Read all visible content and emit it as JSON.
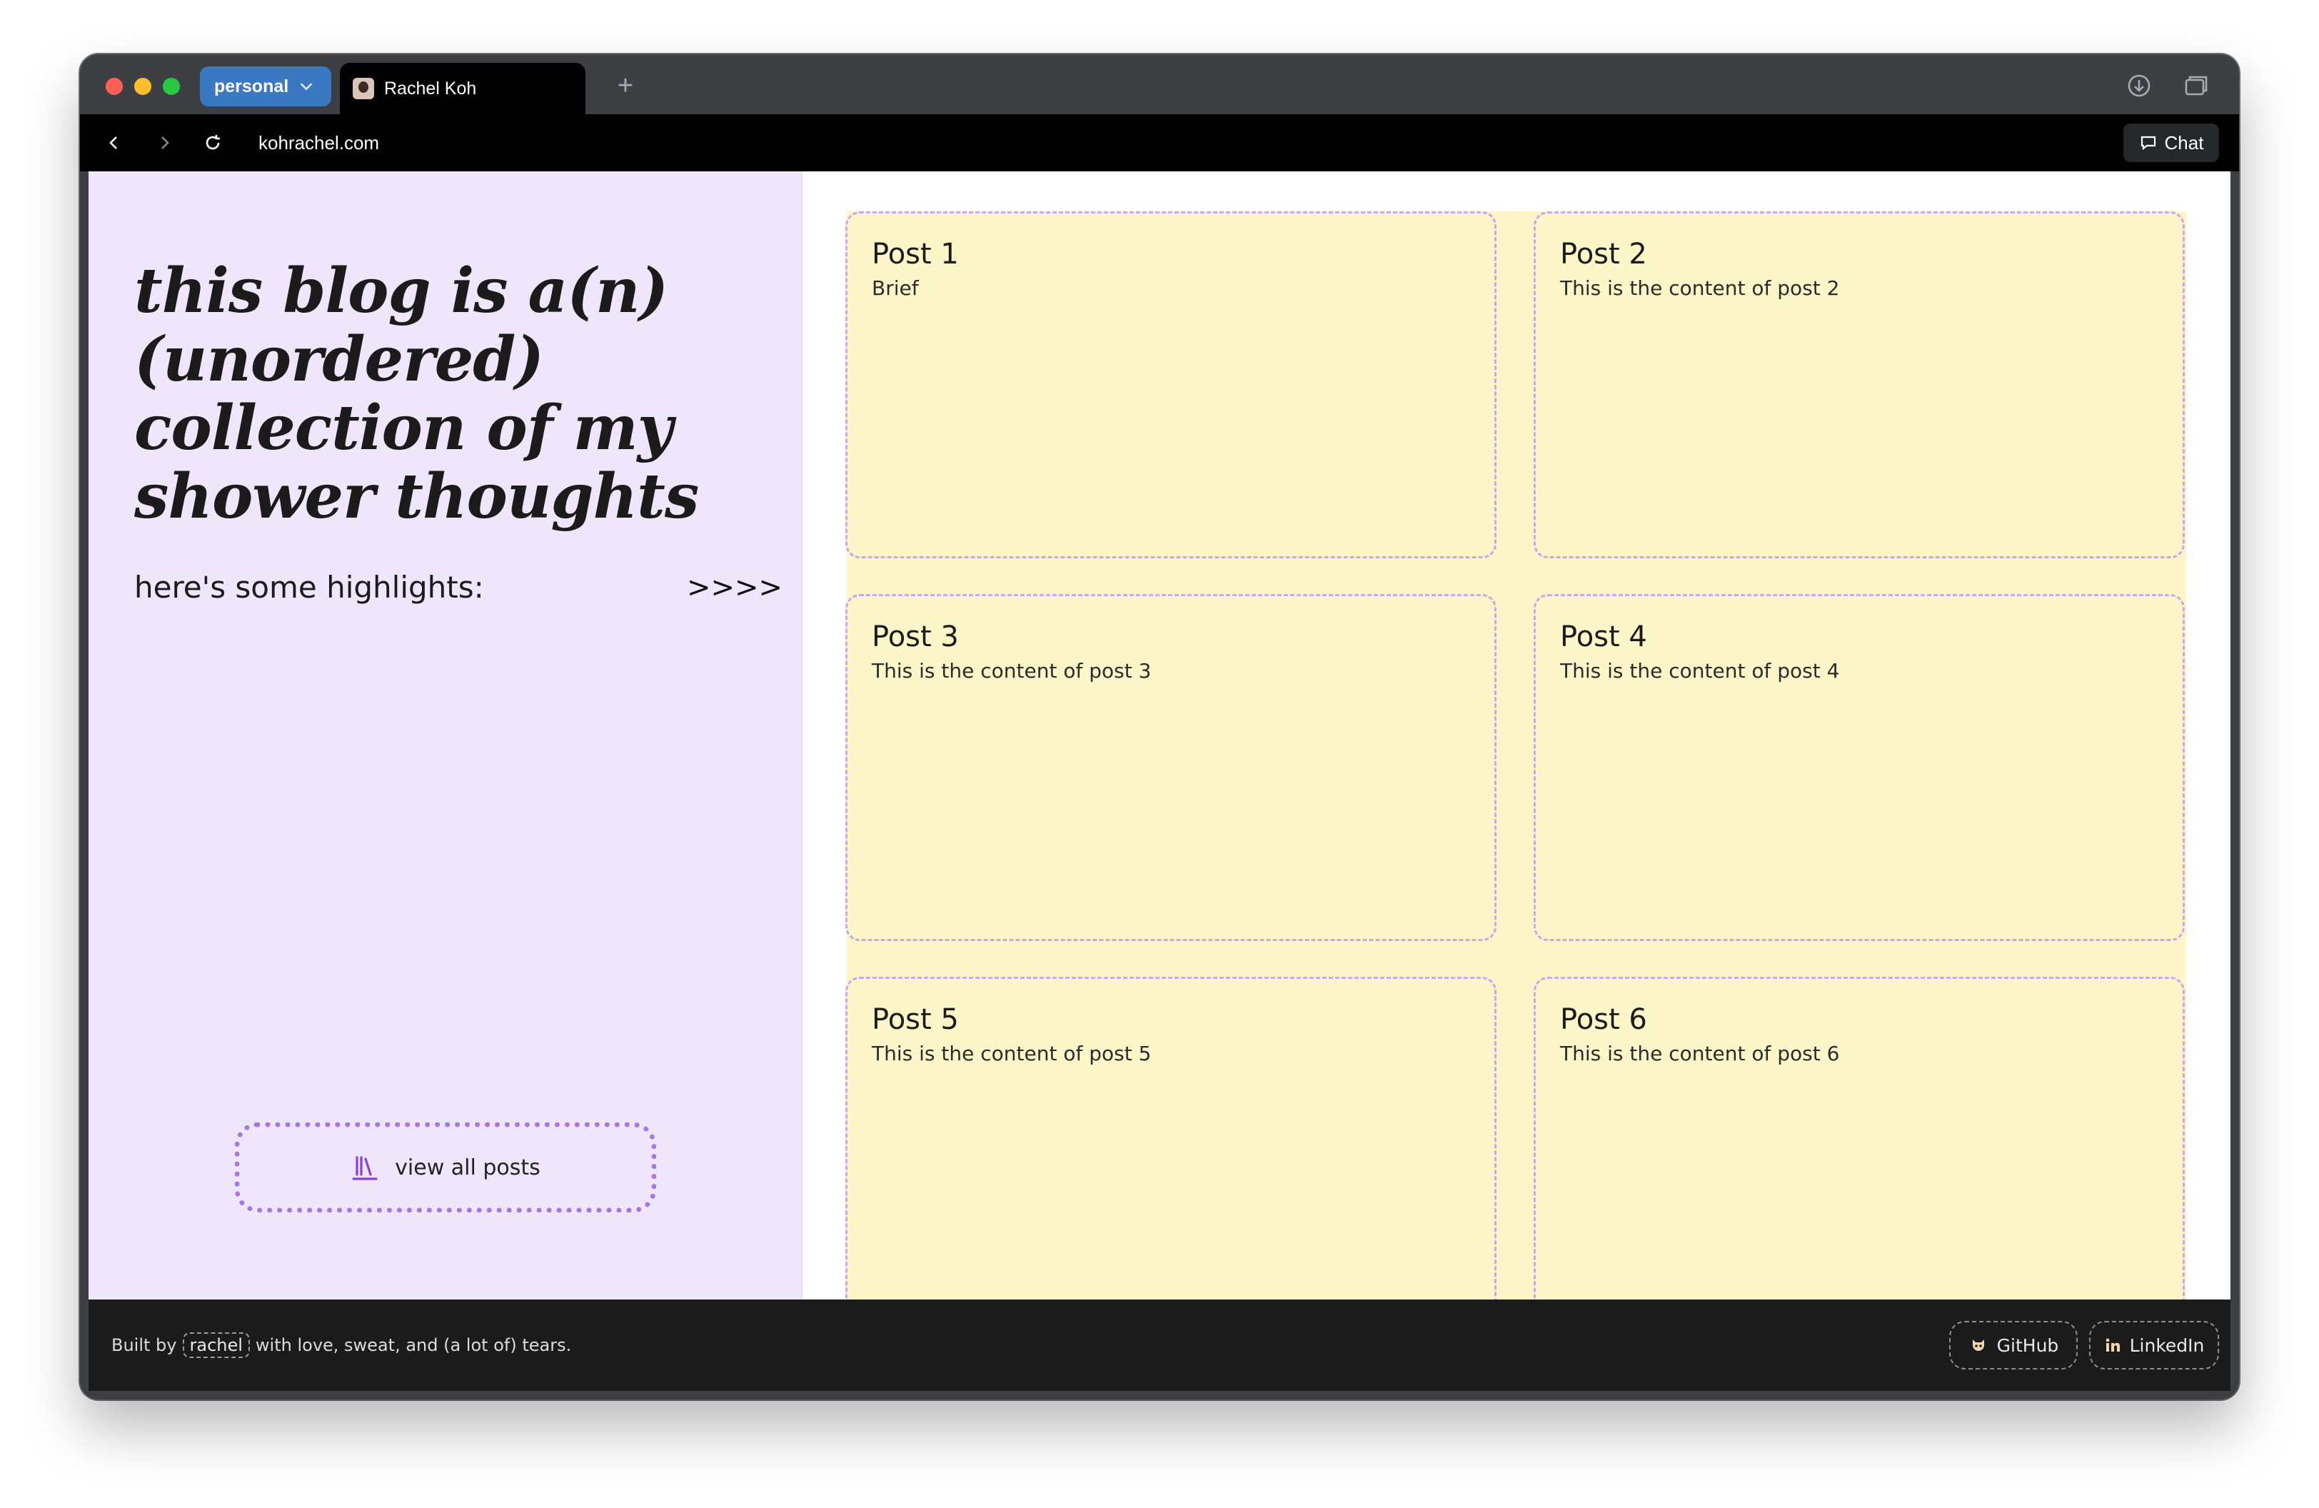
{
  "browser": {
    "profile_label": "personal",
    "tab_title": "Rachel Koh",
    "url": "kohrachel.com",
    "chat_label": "Chat"
  },
  "hero": {
    "headline": "this blog is a(n) (unordered) collection of my shower thoughts",
    "subheading": "here's some highlights:",
    "arrows": ">>>>",
    "view_all_label": "view all posts"
  },
  "posts": [
    {
      "title": "Post 1",
      "body": "Brief"
    },
    {
      "title": "Post 2",
      "body": "This is the content of post 2"
    },
    {
      "title": "Post 3",
      "body": "This is the content of post 3"
    },
    {
      "title": "Post 4",
      "body": "This is the content of post 4"
    },
    {
      "title": "Post 5",
      "body": "This is the content of post 5"
    },
    {
      "title": "Post 6",
      "body": "This is the content of post 6"
    }
  ],
  "footer": {
    "prefix": "Built by",
    "author": "rachel",
    "suffix": "with love, sweat, and (a lot of) tears.",
    "github_label": "GitHub",
    "linkedin_label": "LinkedIn"
  },
  "colors": {
    "left_panel_bg": "#f0e6fb",
    "card_bg": "#fdf6c8",
    "card_border": "#c8a6f0",
    "accent_purple": "#a377e6",
    "footer_bg": "#1b1b1b",
    "profile_pill": "#3b78c2"
  },
  "icons": {
    "download": "download-icon",
    "tabs": "tab-overview-icon",
    "back": "back-icon",
    "forward": "forward-icon",
    "reload": "reload-icon",
    "chat": "chat-bubble-icon",
    "books": "books-icon",
    "github": "github-icon",
    "linkedin": "linkedin-icon"
  }
}
